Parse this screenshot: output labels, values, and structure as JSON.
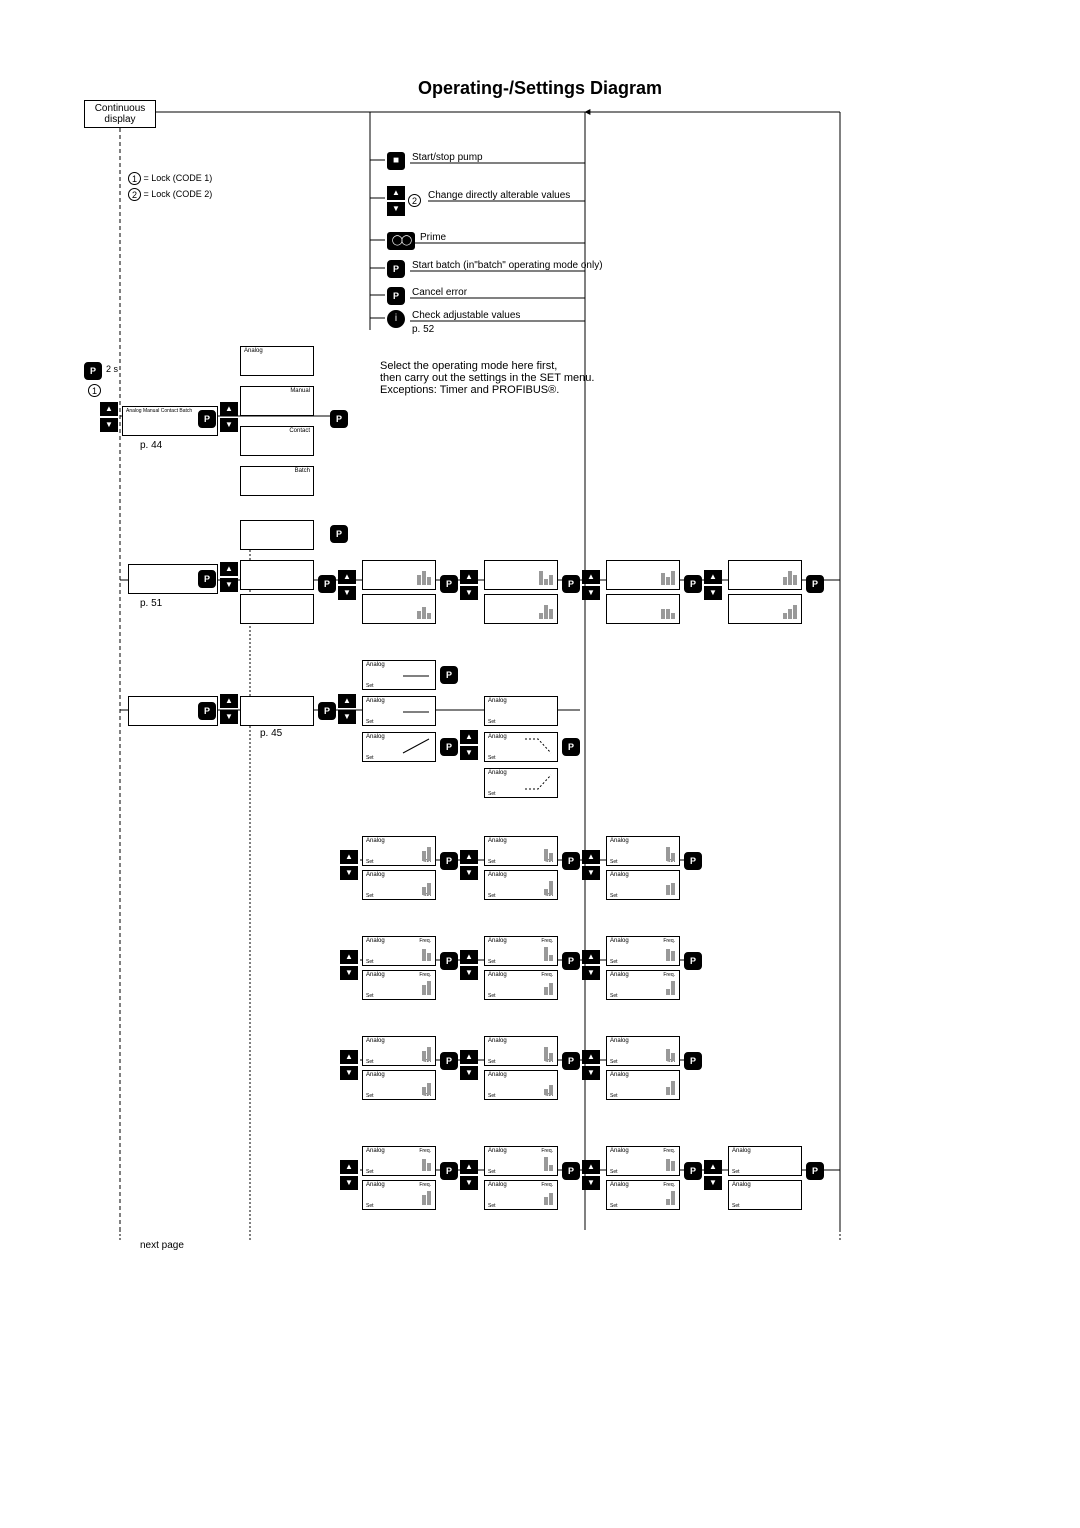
{
  "title": "Operating-/Settings Diagram",
  "top_box": {
    "line1": "Continuous",
    "line2": "display"
  },
  "legend": {
    "row1_circle": "1",
    "row1_text": " = Lock (CODE 1)",
    "row2_circle": "2",
    "row2_text": " = Lock (CODE 2)"
  },
  "actions": {
    "a0": "Start/stop pump",
    "a1": "Change directly alterable values",
    "a2": "Prime",
    "a3": "Start batch (in\"batch\" operating mode only)",
    "a4": "Cancel error",
    "a5": "Check adjustable values",
    "p52": "p. 52"
  },
  "instruction": {
    "l1": "Select the operating mode here first,",
    "l2": "then carry out the settings in the SET menu.",
    "l3": "Exceptions: Timer and PROFIBUS®."
  },
  "left": {
    "p44": "p. 44",
    "p51": "p. 51",
    "p45": "p. 45",
    "two_s": "2 s",
    "circle1": "1",
    "circle2": "2",
    "modebar": "Analog Manual Contact Batch"
  },
  "modes": {
    "analog": "Analog",
    "manual": "Manual",
    "contact": "Contact",
    "batch": "Batch",
    "set": "Set",
    "freq": "Freq.",
    "ma": "mA"
  },
  "footer": "next page",
  "icons": {
    "up": "▲",
    "down": "▼",
    "p": "P"
  }
}
